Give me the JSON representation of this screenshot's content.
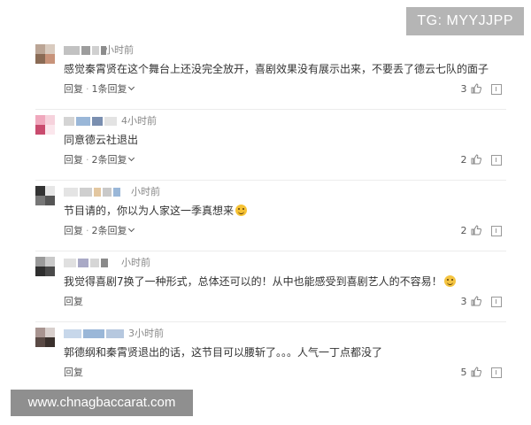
{
  "watermarks": {
    "top_right": "TG: MYYJJPP",
    "bottom_left": "www.chnagbaccarat.com"
  },
  "comments": [
    {
      "time": "小时前",
      "text": "感觉秦霄贤在这个舞台上还没完全放开，喜剧效果没有展示出来，不要丢了德云七队的面子",
      "reply_label": "回复",
      "replies_label": "1条回复",
      "likes": "3",
      "avatar_colors": [
        "#bba595",
        "#8a6b55",
        "#c8937a",
        "#4a3a30"
      ]
    },
    {
      "time": "4小时前",
      "text": "同意德云社退出",
      "reply_label": "回复",
      "replies_label": "2条回复",
      "likes": "2",
      "avatar_colors": [
        "#c94b6e",
        "#f0a8bd",
        "#f6d2dc",
        "#8a3a55"
      ]
    },
    {
      "time": "小时前",
      "text": "节目请的，你以为人家这一季真想来",
      "emoji": "laugh",
      "reply_label": "回复",
      "replies_label": "2条回复",
      "likes": "2",
      "avatar_colors": [
        "#333333",
        "#777777",
        "#e6e6e6",
        "#555555"
      ]
    },
    {
      "time": "小时前",
      "text": "我觉得喜剧7换了一种形式，总体还可以的！从中也能感受到喜剧艺人的不容易！",
      "emoji": "smile",
      "reply_label": "回复",
      "likes": "3",
      "avatar_colors": [
        "#4a4a4a",
        "#9a9a9a",
        "#c9c9c9",
        "#2e2e2e"
      ]
    },
    {
      "time": "3小时前",
      "text": "郭德纲和秦霄贤退出的话，这节目可以腰斩了。。。人气一丁点都没了",
      "reply_label": "回复",
      "likes": "5",
      "avatar_colors": [
        "#5a4a45",
        "#a89490",
        "#d8cfcc",
        "#3a302c"
      ]
    }
  ],
  "colors": {
    "name_blur": [
      "#b8b8b8",
      "#9ab7d8",
      "#c9c9c9",
      "#a9a9c6",
      "#e3c7a0"
    ]
  }
}
